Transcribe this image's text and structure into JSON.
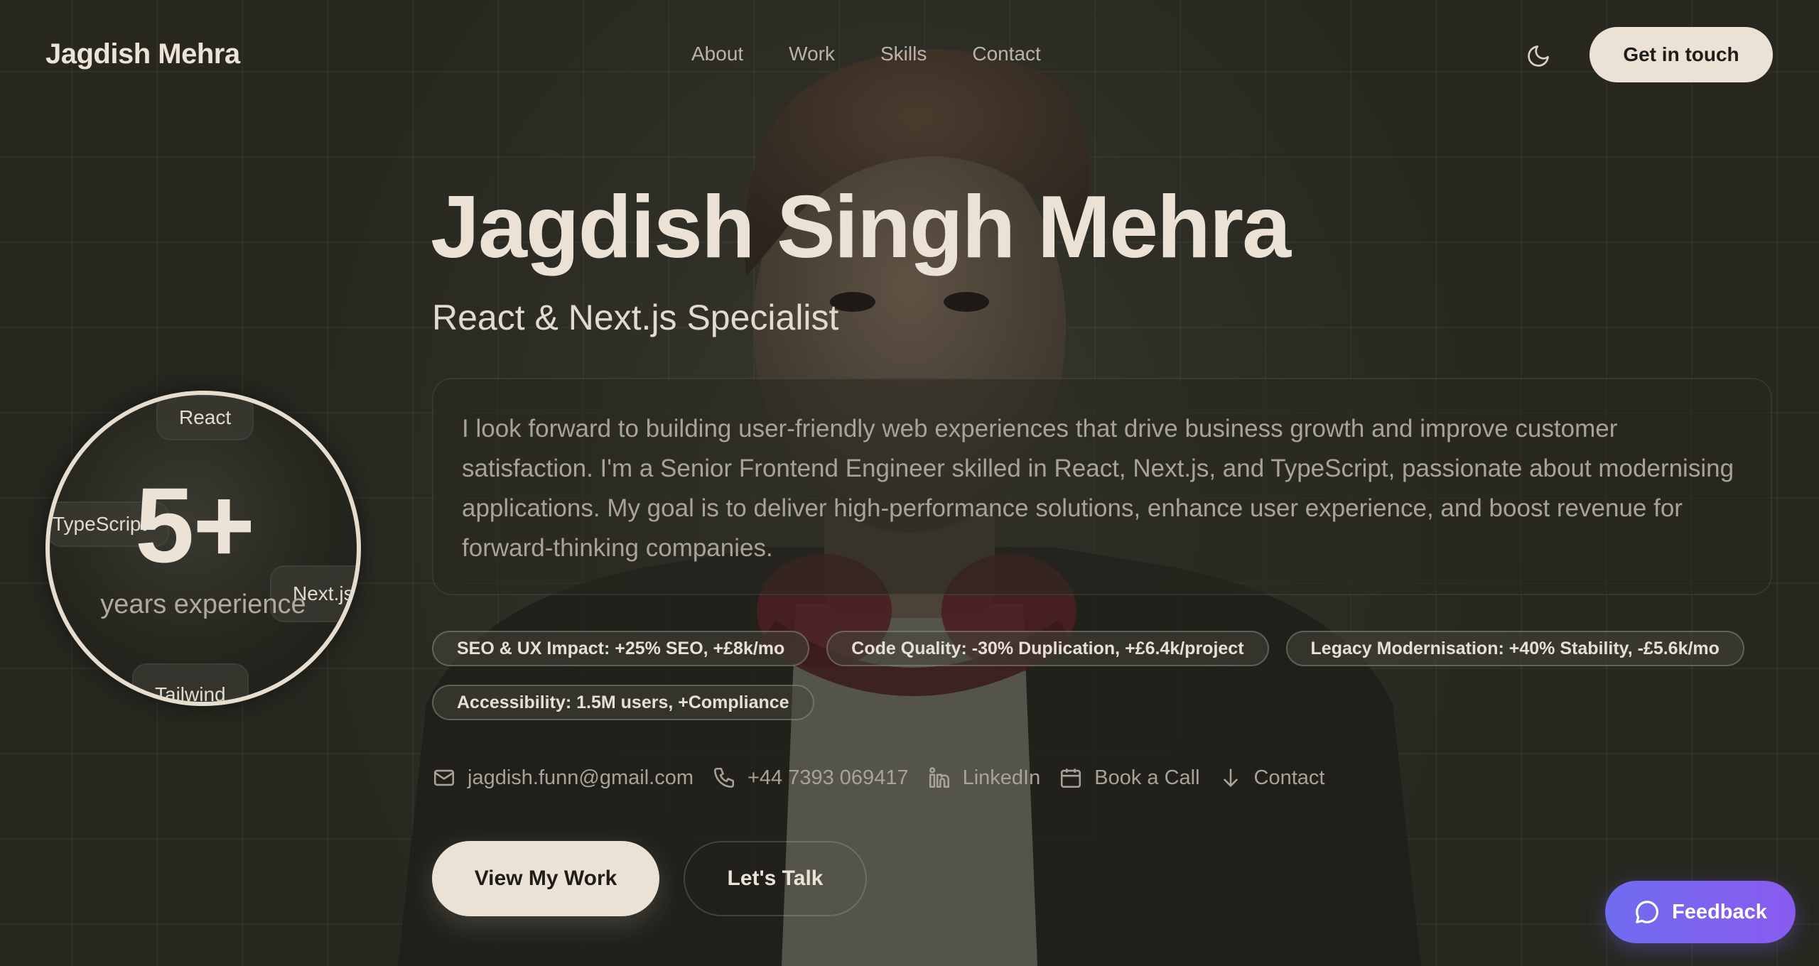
{
  "nav": {
    "brand": "Jagdish Mehra",
    "links": [
      "About",
      "Work",
      "Skills",
      "Contact"
    ],
    "theme_icon": "moon-icon",
    "cta_label": "Get in touch"
  },
  "hero": {
    "name": "Jagdish Singh Mehra",
    "role": "React & Next.js Specialist",
    "bio": "I look forward to building user-friendly web experiences that drive business growth and improve customer satisfaction. I'm a Senior Frontend Engineer skilled in React, Next.js, and TypeScript, passionate about modernising applications. My goal is to deliver high-performance solutions, enhance user experience, and boost revenue for forward-thinking companies.",
    "chips": [
      "SEO & UX Impact: +25% SEO, +£8k/mo",
      "Code Quality: -30% Duplication, +£6.4k/project",
      "Legacy Modernisation: +40% Stability, -£5.6k/mo",
      "Accessibility: 1.5M users, +Compliance"
    ],
    "contacts": [
      {
        "icon": "mail-icon",
        "label": "jagdish.funn@gmail.com"
      },
      {
        "icon": "phone-icon",
        "label": "+44 7393 069417"
      },
      {
        "icon": "linkedin-icon",
        "label": "LinkedIn"
      },
      {
        "icon": "calendar-icon",
        "label": "Book a Call"
      },
      {
        "icon": "arrow-down-icon",
        "label": "Contact"
      }
    ],
    "primary_button": "View My Work",
    "secondary_button": "Let's Talk"
  },
  "experience": {
    "value": "5+",
    "label": "years experience",
    "skills": [
      "React",
      "TypeScript",
      "Next.js",
      "Tailwind"
    ]
  },
  "feedback": {
    "label": "Feedback",
    "icon": "chat-bubble-icon"
  },
  "colors": {
    "background": "#2a2a22",
    "cream": "#ebe2d5",
    "feedback_gradient_start": "#6f6cf0",
    "feedback_gradient_end": "#8a5bf0"
  }
}
